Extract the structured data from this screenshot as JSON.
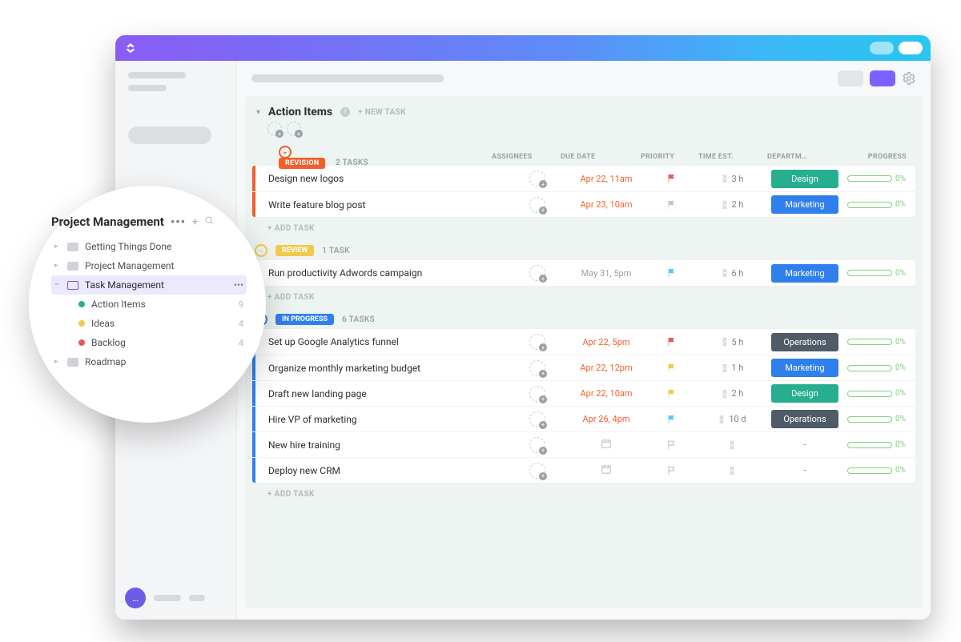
{
  "sidebar": {
    "title": "Project Management",
    "items": [
      {
        "label": "Getting Things Done"
      },
      {
        "label": "Project Management"
      },
      {
        "label": "Task Management",
        "count": ""
      },
      {
        "label": "Action Items",
        "count": "9",
        "dot": "#27ae8f"
      },
      {
        "label": "Ideas",
        "count": "4",
        "dot": "#f2c94c"
      },
      {
        "label": "Backlog",
        "count": "4",
        "dot": "#eb5757"
      },
      {
        "label": "Roadmap"
      }
    ]
  },
  "list": {
    "title": "Action Items",
    "new_task": "+ NEW TASK",
    "add_task": "+ ADD TASK",
    "columns": {
      "assignees": "ASSIGNEES",
      "due": "DUE DATE",
      "priority": "PRIORITY",
      "est": "TIME EST.",
      "dept": "DEPARTM…",
      "progress": "PROGRESS"
    }
  },
  "sections": [
    {
      "id": "revision",
      "label": "REVISION",
      "count": "2 TASKS",
      "color": "#f25f2b",
      "rows": [
        {
          "title": "Design new logos",
          "due": "Apr 22, 11am",
          "due_soon": true,
          "flag": "#eb5757",
          "est": "3 h",
          "dept": "Design",
          "pct": "0%"
        },
        {
          "title": "Write feature blog post",
          "due": "Apr 23, 10am",
          "due_soon": true,
          "flag": "#c2c6cc",
          "est": "2 h",
          "dept": "Marketing",
          "pct": "0%"
        }
      ]
    },
    {
      "id": "review",
      "label": "REVIEW",
      "count": "1 TASK",
      "color": "#f2c94c",
      "rows": [
        {
          "title": "Run productivity Adwords campaign",
          "due": "May 31, 5pm",
          "due_soon": false,
          "flag": "#56ccf2",
          "est": "6 h",
          "dept": "Marketing",
          "pct": "0%"
        }
      ]
    },
    {
      "id": "progress",
      "label": "IN PROGRESS",
      "count": "6 TASKS",
      "color": "#2f80ed",
      "rows": [
        {
          "title": "Set up Google Analytics funnel",
          "due": "Apr 22, 5pm",
          "due_soon": true,
          "flag": "#eb5757",
          "est": "5 h",
          "dept": "Operations",
          "pct": "0%"
        },
        {
          "title": "Organize monthly marketing budget",
          "due": "Apr 22, 12pm",
          "due_soon": true,
          "flag": "#f2c94c",
          "est": "1 h",
          "dept": "Marketing",
          "pct": "0%"
        },
        {
          "title": "Draft new landing page",
          "due": "Apr 22, 10am",
          "due_soon": true,
          "flag": "#f2c94c",
          "est": "2 h",
          "dept": "Design",
          "pct": "0%"
        },
        {
          "title": "Hire VP of marketing",
          "due": "Apr 26, 4pm",
          "due_soon": true,
          "flag": "#56ccf2",
          "est": "10 d",
          "dept": "Operations",
          "pct": "0%"
        },
        {
          "title": "New hire training",
          "due": "",
          "due_soon": false,
          "flag": "",
          "est": "",
          "dept": "-",
          "pct": "0%"
        },
        {
          "title": "Deploy new CRM",
          "due": "",
          "due_soon": false,
          "flag": "",
          "est": "",
          "dept": "-",
          "pct": "0%"
        }
      ]
    }
  ]
}
